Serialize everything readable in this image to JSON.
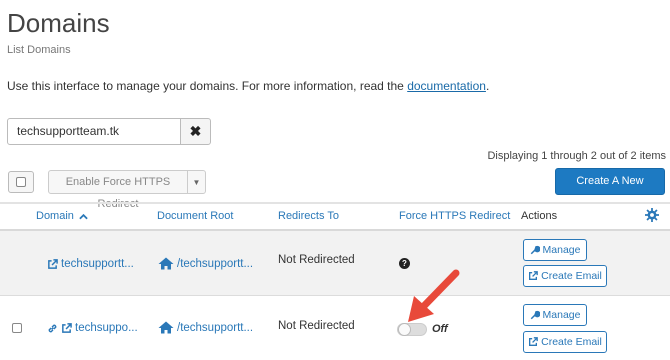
{
  "page": {
    "title": "Domains",
    "subtitle": "List Domains",
    "info_text": "Use this interface to manage your domains. For more information, read the ",
    "info_link": "documentation",
    "info_suffix": "."
  },
  "search": {
    "value": "techsupportteam.tk",
    "clear_glyph": "✖"
  },
  "toolbar": {
    "displaying": "Displaying 1 through 2 out of 2 items",
    "bulk_label": "Enable Force HTTPS Redirect",
    "create_label": "Create A New Domain",
    "accent": "#1d7ac2"
  },
  "table": {
    "headers": {
      "domain": "Domain",
      "document_root": "Document Root",
      "redirects_to": "Redirects To",
      "force_https": "Force HTTPS Redirect",
      "actions": "Actions"
    },
    "rows": [
      {
        "domain": "techsupportt...",
        "document_root": "/techsupportt...",
        "redirects_to": "Not Redirected",
        "force_https": "?",
        "manage_label": "Manage",
        "email_label": "Create Email"
      },
      {
        "domain": "techsuppo...",
        "document_root": "/techsupportt...",
        "redirects_to": "Not Redirected",
        "force_https": "Off",
        "manage_label": "Manage",
        "email_label": "Create Email"
      }
    ]
  },
  "icons": [
    "external-link-icon",
    "home-icon",
    "link-icon",
    "wrench-icon",
    "gear-icon",
    "question-icon",
    "sort-up-icon",
    "caret-down-icon",
    "close-icon",
    "arrow-annotation"
  ]
}
